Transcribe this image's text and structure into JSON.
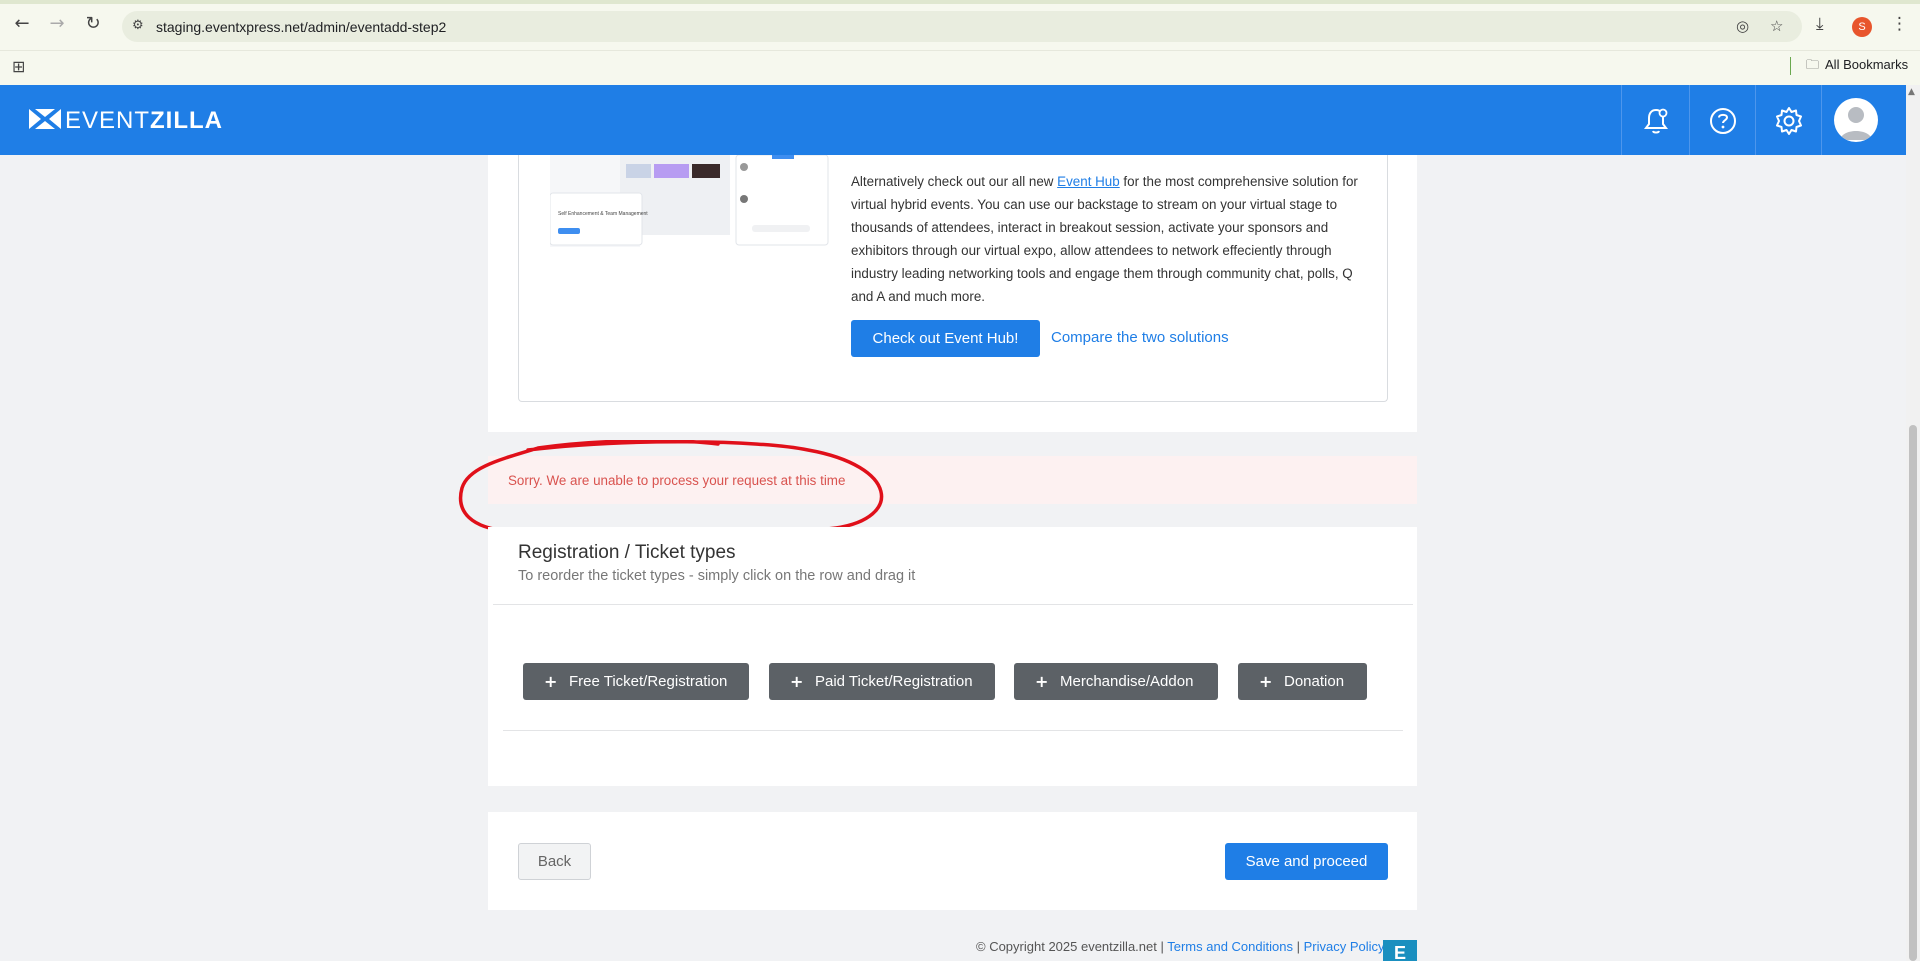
{
  "browser": {
    "url": "staging.eventxpress.net/admin/eventadd-step2",
    "profile_initial": "S",
    "bookmarks_label": "All Bookmarks"
  },
  "header": {
    "logo_light": "EVENT",
    "logo_bold": "ZILLA",
    "colors": {
      "brand": "#1f7ee6"
    }
  },
  "event_hub": {
    "text_before_link": "Alternatively check out our all new ",
    "link_text": "Event Hub",
    "text_after_link": " for the most comprehensive solution for virtual hybrid events. You can use our backstage to stream on your virtual stage to thousands of attendees, interact in breakout session, activate your sponsors and exhibitors through our virtual expo, allow attendees to network effeciently through industry leading networking tools and engage them through community chat, polls, Q and A and much more.",
    "cta_label": "Check out Event Hub!",
    "compare_label": "Compare the two solutions",
    "thumb_caption": "Self Enhancement & Team Management"
  },
  "alert": {
    "message": "Sorry. We are unable to process your request at this time",
    "color": "#d9534f"
  },
  "tickets": {
    "title": "Registration / Ticket types",
    "subtitle": "To reorder the ticket types - simply click on the row and drag it",
    "buttons": [
      {
        "label": "Free Ticket/Registration"
      },
      {
        "label": "Paid Ticket/Registration"
      },
      {
        "label": "Merchandise/Addon"
      },
      {
        "label": "Donation"
      }
    ]
  },
  "actions": {
    "back_label": "Back",
    "save_label": "Save and proceed"
  },
  "footer": {
    "copyright": "© Copyright 2025 eventzilla.net |",
    "terms": "Terms and Conditions",
    "separator": "|",
    "privacy": "Privacy Policy",
    "badge": "E"
  }
}
